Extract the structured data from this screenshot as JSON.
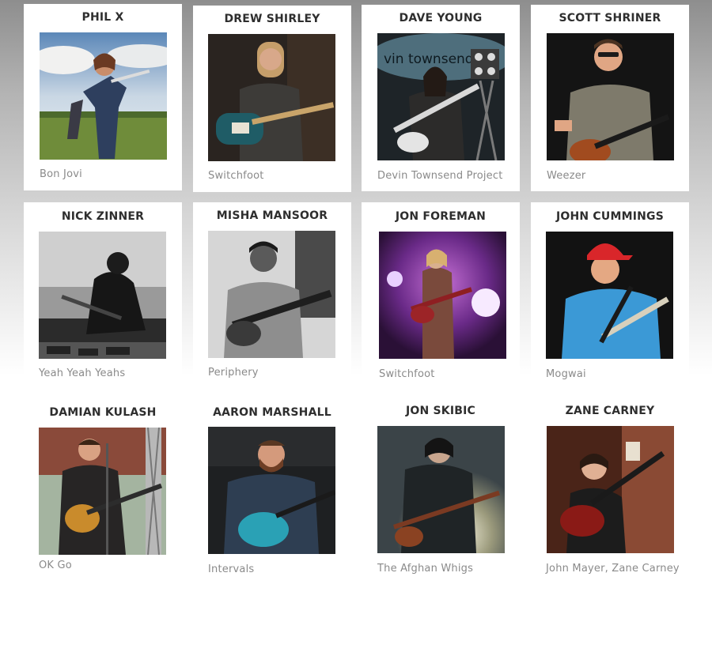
{
  "musicians": [
    {
      "name": "PHIL X",
      "band": "Bon Jovi",
      "photo": "phil-x-photo"
    },
    {
      "name": "DREW SHIRLEY",
      "band": "Switchfoot",
      "photo": "drew-shirley-photo"
    },
    {
      "name": "DAVE YOUNG",
      "band": "Devin Townsend Project",
      "photo": "dave-young-photo"
    },
    {
      "name": "SCOTT SHRINER",
      "band": "Weezer",
      "photo": "scott-shriner-photo"
    },
    {
      "name": "NICK ZINNER",
      "band": "Yeah Yeah Yeahs",
      "photo": "nick-zinner-photo"
    },
    {
      "name": "MISHA MANSOOR",
      "band": "Periphery",
      "photo": "misha-mansoor-photo"
    },
    {
      "name": "JON FOREMAN",
      "band": "Switchfoot",
      "photo": "jon-foreman-photo"
    },
    {
      "name": "JOHN CUMMINGS",
      "band": "Mogwai",
      "photo": "john-cummings-photo"
    },
    {
      "name": "DAMIAN KULASH",
      "band": "OK Go",
      "photo": "damian-kulash-photo"
    },
    {
      "name": "AARON MARSHALL",
      "band": "Intervals",
      "photo": "aaron-marshall-photo"
    },
    {
      "name": "JON SKIBIC",
      "band": "The Afghan Whigs",
      "photo": "jon-skibic-photo"
    },
    {
      "name": "ZANE CARNEY",
      "band": "John Mayer, Zane Carney",
      "photo": "zane-carney-photo"
    }
  ],
  "photo_text": {
    "dave_young_banner": "vin townsend p"
  }
}
